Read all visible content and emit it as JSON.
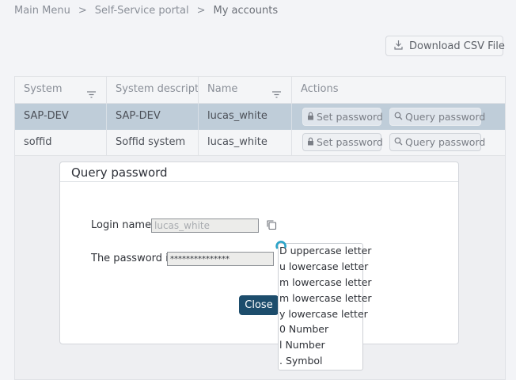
{
  "breadcrumb": {
    "items": [
      "Main Menu",
      "Self-Service portal",
      "My accounts"
    ],
    "separator": ">"
  },
  "toolbar": {
    "download_label": "Download CSV File"
  },
  "table": {
    "columns": [
      "System",
      "System description",
      "Name",
      "Actions"
    ],
    "rows": [
      {
        "system": "SAP-DEV",
        "description": "SAP-DEV",
        "name": "lucas_white",
        "selected": true
      },
      {
        "system": "soffid",
        "description": "Soffid system",
        "name": "lucas_white",
        "selected": false
      }
    ],
    "actions": {
      "set_password": "Set password",
      "query_password": "Query password"
    }
  },
  "dialog": {
    "title": "Query password",
    "login_label": "Login name :",
    "login_value": "lucas_white",
    "password_label": "The password is:",
    "password_value": "***************",
    "close_label": "Close"
  },
  "password_hint": {
    "lines": [
      "D uppercase letter",
      "u lowercase letter",
      "m lowercase letter",
      "m lowercase letter",
      "y lowercase letter",
      "0 Number",
      "l Number",
      ". Symbol"
    ]
  },
  "colors": {
    "accent": "#1d4d6c",
    "selected_row": "#bfcdd9",
    "spinner": "#2aa3c8"
  }
}
